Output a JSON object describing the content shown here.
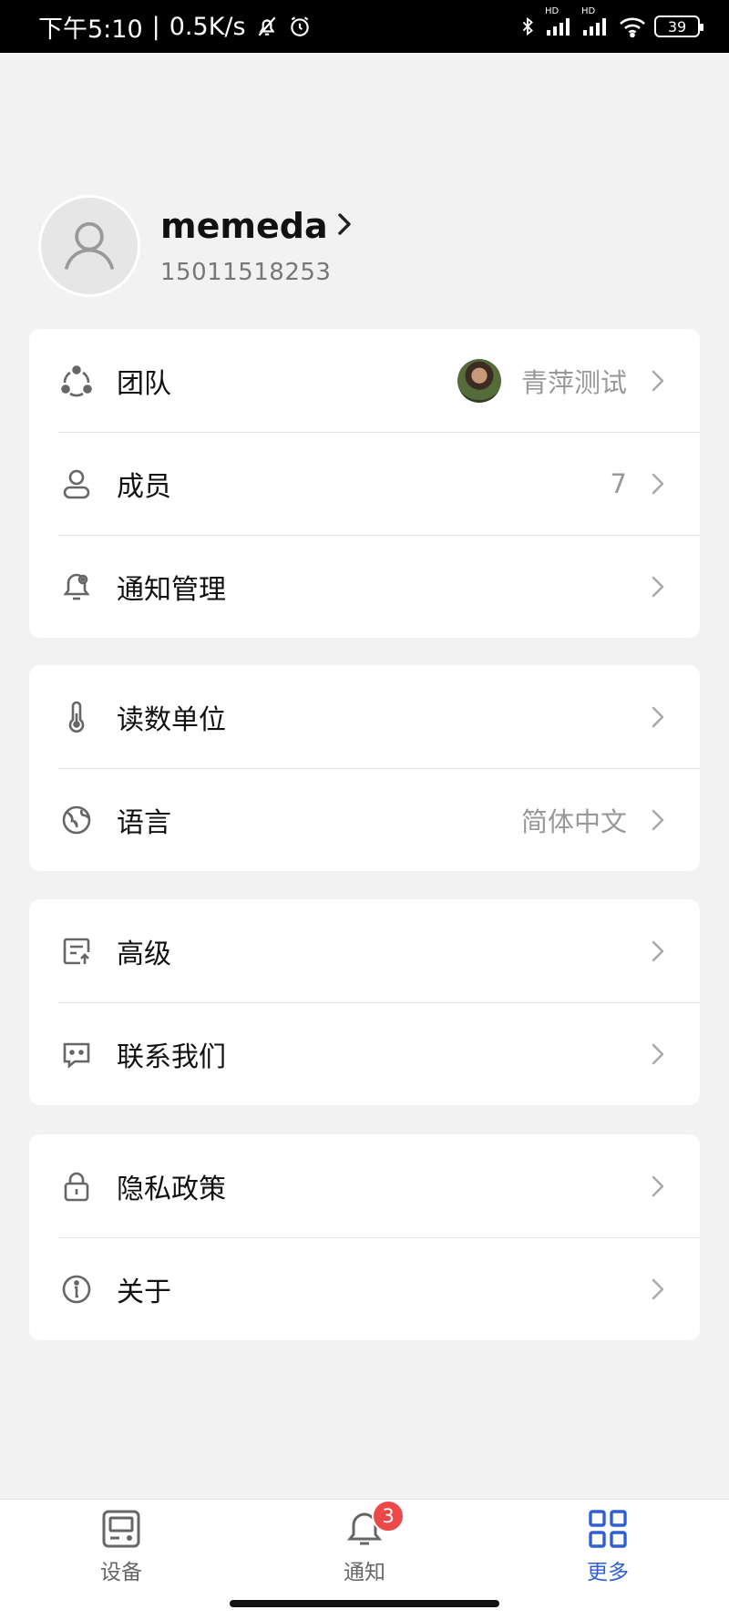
{
  "status_bar": {
    "time": "下午5:10",
    "network_speed": "0.5K/s",
    "battery": "39",
    "hd_label": "HD",
    "icons": [
      "bell-off-icon",
      "alarm-icon",
      "bluetooth-icon",
      "signal-icon",
      "wifi-icon",
      "battery-icon"
    ]
  },
  "profile": {
    "name": "memeda",
    "phone": "15011518253"
  },
  "groups": [
    {
      "items": [
        {
          "label": "团队",
          "value": "青萍测试",
          "icon": "team-icon"
        },
        {
          "label": "成员",
          "value": "7",
          "icon": "member-icon"
        },
        {
          "label": "通知管理",
          "value": "",
          "icon": "notification-settings-icon"
        }
      ]
    },
    {
      "items": [
        {
          "label": "读数单位",
          "value": "",
          "icon": "thermometer-icon"
        },
        {
          "label": "语言",
          "value": "简体中文",
          "icon": "globe-icon"
        }
      ]
    },
    {
      "items": [
        {
          "label": "高级",
          "value": "",
          "icon": "advanced-icon"
        },
        {
          "label": "联系我们",
          "value": "",
          "icon": "message-icon"
        }
      ]
    },
    {
      "items": [
        {
          "label": "隐私政策",
          "value": "",
          "icon": "lock-icon"
        },
        {
          "label": "关于",
          "value": "",
          "icon": "info-icon"
        }
      ]
    }
  ],
  "tabbar": {
    "tabs": [
      {
        "label": "设备",
        "icon": "device-icon",
        "active": false
      },
      {
        "label": "通知",
        "icon": "bell-icon",
        "active": false,
        "badge": "3"
      },
      {
        "label": "更多",
        "icon": "grid-icon",
        "active": true
      }
    ]
  },
  "colors": {
    "accent": "#2f5fd3",
    "badge": "#ec4a4a",
    "background": "#f2f2f2"
  }
}
